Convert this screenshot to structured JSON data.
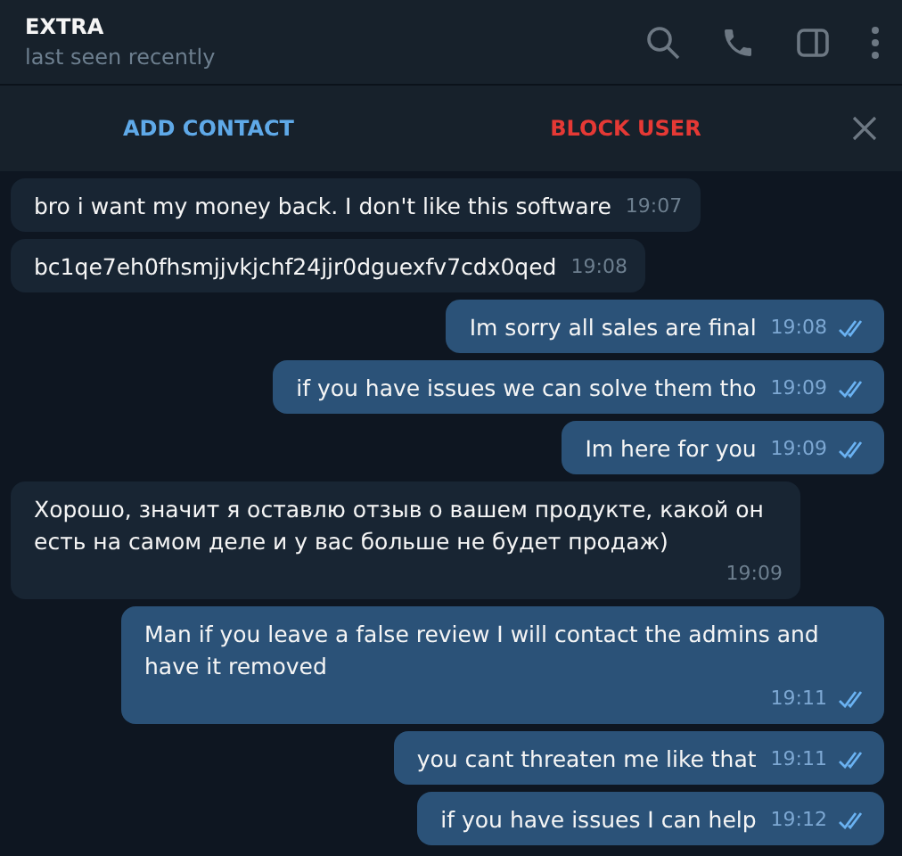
{
  "header": {
    "title": "EXTRA",
    "status": "last seen recently"
  },
  "action_bar": {
    "add_contact": "ADD CONTACT",
    "block_user": "BLOCK USER"
  },
  "messages": [
    {
      "kind": "incoming",
      "text": "bro i want my money back. I don't like this software",
      "time": "19:07"
    },
    {
      "kind": "incoming",
      "text": "bc1qe7eh0fhsmjjvkjchf24jjr0dguexfv7cdx0qed",
      "time": "19:08"
    },
    {
      "kind": "outgoing",
      "text": "Im sorry all sales are final",
      "time": "19:08",
      "read": true
    },
    {
      "kind": "outgoing",
      "text": "if you have issues we can solve them tho",
      "time": "19:09",
      "read": true
    },
    {
      "kind": "outgoing",
      "text": "Im here for you",
      "time": "19:09",
      "read": true
    },
    {
      "kind": "incoming",
      "text": "Хорошо, значит я оставлю отзыв о вашем продукте, какой он есть на самом деле и у вас больше не будет продаж)",
      "time": "19:09"
    },
    {
      "kind": "outgoing",
      "text": "Man if you leave a false review I will contact the admins and have it removed",
      "time": "19:11",
      "read": true
    },
    {
      "kind": "outgoing",
      "text": "you cant threaten me like that",
      "time": "19:11",
      "read": true
    },
    {
      "kind": "outgoing",
      "text": "if you have issues I can help",
      "time": "19:12",
      "read": true
    }
  ]
}
